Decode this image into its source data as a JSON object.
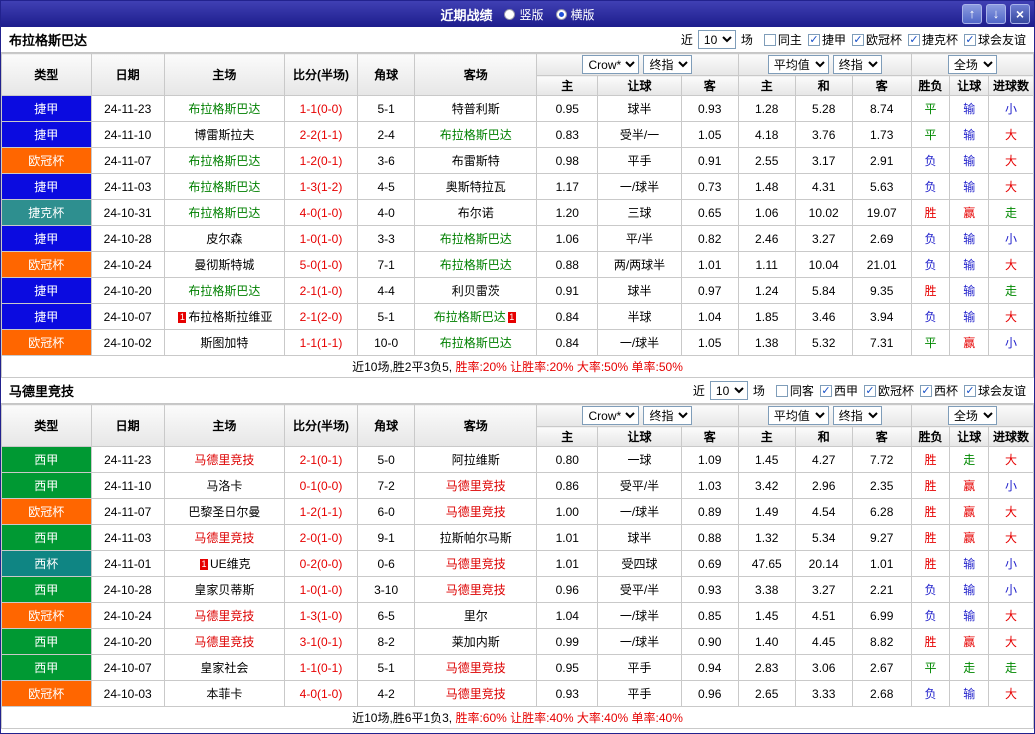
{
  "titlebar": {
    "title": "近期战绩",
    "views": [
      {
        "label": "竖版",
        "selected": false
      },
      {
        "label": "横版",
        "selected": true
      }
    ],
    "up": "↑",
    "down": "↓",
    "close": "×"
  },
  "league_colors": {
    "捷甲": "#0b0be0",
    "欧冠杯": "#ff6600",
    "捷克杯": "#2e8f8f",
    "西甲": "#009933",
    "西杯": "#0f8583"
  },
  "res_colors": {
    "r": "#e60000",
    "g": "#008800",
    "b": "#2222cc",
    "k": "#000000"
  },
  "sections": [
    {
      "team": "布拉格斯巴达",
      "focus_color": "#008000",
      "filters": {
        "near_label": "近",
        "count": "10",
        "games_label": "场",
        "checkboxes": [
          {
            "label": "同主",
            "checked": false
          },
          {
            "label": "捷甲",
            "checked": true
          },
          {
            "label": "欧冠杯",
            "checked": true
          },
          {
            "label": "捷克杯",
            "checked": true
          },
          {
            "label": "球会友谊",
            "checked": true
          }
        ]
      },
      "table": {
        "static_headers": [
          "类型",
          "日期",
          "主场",
          "比分(半场)",
          "角球",
          "客场"
        ],
        "odds_selects": [
          "Crow*",
          "终指"
        ],
        "odds_headers": [
          "主",
          "让球",
          "客"
        ],
        "avg_selects": [
          "平均值",
          "终指"
        ],
        "avg_headers": [
          "主",
          "和",
          "客"
        ],
        "result_select": "全场",
        "result_headers": [
          "胜负",
          "让球",
          "进球数"
        ],
        "rows": [
          {
            "league": "捷甲",
            "date": "24-11-23",
            "home": {
              "n": "布拉格斯巴达",
              "f": 1
            },
            "score": "1-1(0-0)",
            "corner": "5-1",
            "away": {
              "n": "特普利斯"
            },
            "odds": [
              "0.95",
              "球半",
              "0.93"
            ],
            "avg": [
              "1.28",
              "5.28",
              "8.74"
            ],
            "res": [
              [
                "平",
                "g"
              ],
              [
                "输",
                "b"
              ],
              [
                "小",
                "b"
              ]
            ]
          },
          {
            "league": "捷甲",
            "date": "24-11-10",
            "home": {
              "n": "博雷斯拉夫"
            },
            "score": "2-2(1-1)",
            "corner": "2-4",
            "away": {
              "n": "布拉格斯巴达",
              "f": 1
            },
            "odds": [
              "0.83",
              "受半/一",
              "1.05"
            ],
            "avg": [
              "4.18",
              "3.76",
              "1.73"
            ],
            "res": [
              [
                "平",
                "g"
              ],
              [
                "输",
                "b"
              ],
              [
                "大",
                "r"
              ]
            ]
          },
          {
            "league": "欧冠杯",
            "date": "24-11-07",
            "home": {
              "n": "布拉格斯巴达",
              "f": 1
            },
            "score": "1-2(0-1)",
            "corner": "3-6",
            "away": {
              "n": "布雷斯特"
            },
            "odds": [
              "0.98",
              "平手",
              "0.91"
            ],
            "avg": [
              "2.55",
              "3.17",
              "2.91"
            ],
            "res": [
              [
                "负",
                "b"
              ],
              [
                "输",
                "b"
              ],
              [
                "大",
                "r"
              ]
            ]
          },
          {
            "league": "捷甲",
            "date": "24-11-03",
            "home": {
              "n": "布拉格斯巴达",
              "f": 1
            },
            "score": "1-3(1-2)",
            "corner": "4-5",
            "away": {
              "n": "奥斯特拉瓦"
            },
            "odds": [
              "1.17",
              "一/球半",
              "0.73"
            ],
            "avg": [
              "1.48",
              "4.31",
              "5.63"
            ],
            "res": [
              [
                "负",
                "b"
              ],
              [
                "输",
                "b"
              ],
              [
                "大",
                "r"
              ]
            ]
          },
          {
            "league": "捷克杯",
            "date": "24-10-31",
            "home": {
              "n": "布拉格斯巴达",
              "f": 1
            },
            "score": "4-0(1-0)",
            "corner": "4-0",
            "away": {
              "n": "布尔诺"
            },
            "odds": [
              "1.20",
              "三球",
              "0.65"
            ],
            "avg": [
              "1.06",
              "10.02",
              "19.07"
            ],
            "res": [
              [
                "胜",
                "r"
              ],
              [
                "赢",
                "r"
              ],
              [
                "走",
                "g"
              ]
            ]
          },
          {
            "league": "捷甲",
            "date": "24-10-28",
            "home": {
              "n": "皮尔森"
            },
            "score": "1-0(1-0)",
            "corner": "3-3",
            "away": {
              "n": "布拉格斯巴达",
              "f": 1
            },
            "odds": [
              "1.06",
              "平/半",
              "0.82"
            ],
            "avg": [
              "2.46",
              "3.27",
              "2.69"
            ],
            "res": [
              [
                "负",
                "b"
              ],
              [
                "输",
                "b"
              ],
              [
                "小",
                "b"
              ]
            ]
          },
          {
            "league": "欧冠杯",
            "date": "24-10-24",
            "home": {
              "n": "曼彻斯特城"
            },
            "score": "5-0(1-0)",
            "corner": "7-1",
            "away": {
              "n": "布拉格斯巴达",
              "f": 1
            },
            "odds": [
              "0.88",
              "两/两球半",
              "1.01"
            ],
            "avg": [
              "1.11",
              "10.04",
              "21.01"
            ],
            "res": [
              [
                "负",
                "b"
              ],
              [
                "输",
                "b"
              ],
              [
                "大",
                "r"
              ]
            ]
          },
          {
            "league": "捷甲",
            "date": "24-10-20",
            "home": {
              "n": "布拉格斯巴达",
              "f": 1
            },
            "score": "2-1(1-0)",
            "corner": "4-4",
            "away": {
              "n": "利贝雷茨"
            },
            "odds": [
              "0.91",
              "球半",
              "0.97"
            ],
            "avg": [
              "1.24",
              "5.84",
              "9.35"
            ],
            "res": [
              [
                "胜",
                "r"
              ],
              [
                "输",
                "b"
              ],
              [
                "走",
                "g"
              ]
            ]
          },
          {
            "league": "捷甲",
            "date": "24-10-07",
            "home": {
              "n": "布拉格斯拉维亚",
              "rc": "L"
            },
            "score": "2-1(2-0)",
            "corner": "5-1",
            "away": {
              "n": "布拉格斯巴达",
              "f": 1,
              "rc": "R"
            },
            "odds": [
              "0.84",
              "半球",
              "1.04"
            ],
            "avg": [
              "1.85",
              "3.46",
              "3.94"
            ],
            "res": [
              [
                "负",
                "b"
              ],
              [
                "输",
                "b"
              ],
              [
                "大",
                "r"
              ]
            ]
          },
          {
            "league": "欧冠杯",
            "date": "24-10-02",
            "home": {
              "n": "斯图加特"
            },
            "score": "1-1(1-1)",
            "corner": "10-0",
            "away": {
              "n": "布拉格斯巴达",
              "f": 1
            },
            "odds": [
              "0.84",
              "一/球半",
              "1.05"
            ],
            "avg": [
              "1.38",
              "5.32",
              "7.31"
            ],
            "res": [
              [
                "平",
                "g"
              ],
              [
                "赢",
                "r"
              ],
              [
                "小",
                "b"
              ]
            ]
          }
        ],
        "summary": [
          [
            "近10场,胜2平3负5, ",
            "k"
          ],
          [
            "胜率:20% ",
            "r"
          ],
          [
            "让胜率:20% ",
            "r"
          ],
          [
            "大率:50% ",
            "r"
          ],
          [
            "单率:50%",
            "r"
          ]
        ]
      }
    },
    {
      "team": "马德里竞技",
      "focus_color": "#dd0000",
      "filters": {
        "near_label": "近",
        "count": "10",
        "games_label": "场",
        "checkboxes": [
          {
            "label": "同客",
            "checked": false
          },
          {
            "label": "西甲",
            "checked": true
          },
          {
            "label": "欧冠杯",
            "checked": true
          },
          {
            "label": "西杯",
            "checked": true
          },
          {
            "label": "球会友谊",
            "checked": true
          }
        ]
      },
      "table": {
        "static_headers": [
          "类型",
          "日期",
          "主场",
          "比分(半场)",
          "角球",
          "客场"
        ],
        "odds_selects": [
          "Crow*",
          "终指"
        ],
        "odds_headers": [
          "主",
          "让球",
          "客"
        ],
        "avg_selects": [
          "平均值",
          "终指"
        ],
        "avg_headers": [
          "主",
          "和",
          "客"
        ],
        "result_select": "全场",
        "result_headers": [
          "胜负",
          "让球",
          "进球数"
        ],
        "rows": [
          {
            "league": "西甲",
            "date": "24-11-23",
            "home": {
              "n": "马德里竞技",
              "f": 1
            },
            "score": "2-1(0-1)",
            "corner": "5-0",
            "away": {
              "n": "阿拉维斯"
            },
            "odds": [
              "0.80",
              "一球",
              "1.09"
            ],
            "avg": [
              "1.45",
              "4.27",
              "7.72"
            ],
            "res": [
              [
                "胜",
                "r"
              ],
              [
                "走",
                "g"
              ],
              [
                "大",
                "r"
              ]
            ]
          },
          {
            "league": "西甲",
            "date": "24-11-10",
            "home": {
              "n": "马洛卡"
            },
            "score": "0-1(0-0)",
            "corner": "7-2",
            "away": {
              "n": "马德里竞技",
              "f": 1
            },
            "odds": [
              "0.86",
              "受平/半",
              "1.03"
            ],
            "avg": [
              "3.42",
              "2.96",
              "2.35"
            ],
            "res": [
              [
                "胜",
                "r"
              ],
              [
                "赢",
                "r"
              ],
              [
                "小",
                "b"
              ]
            ]
          },
          {
            "league": "欧冠杯",
            "date": "24-11-07",
            "home": {
              "n": "巴黎圣日尔曼"
            },
            "score": "1-2(1-1)",
            "corner": "6-0",
            "away": {
              "n": "马德里竞技",
              "f": 1
            },
            "odds": [
              "1.00",
              "一/球半",
              "0.89"
            ],
            "avg": [
              "1.49",
              "4.54",
              "6.28"
            ],
            "res": [
              [
                "胜",
                "r"
              ],
              [
                "赢",
                "r"
              ],
              [
                "大",
                "r"
              ]
            ]
          },
          {
            "league": "西甲",
            "date": "24-11-03",
            "home": {
              "n": "马德里竞技",
              "f": 1
            },
            "score": "2-0(1-0)",
            "corner": "9-1",
            "away": {
              "n": "拉斯帕尔马斯"
            },
            "odds": [
              "1.01",
              "球半",
              "0.88"
            ],
            "avg": [
              "1.32",
              "5.34",
              "9.27"
            ],
            "res": [
              [
                "胜",
                "r"
              ],
              [
                "赢",
                "r"
              ],
              [
                "大",
                "r"
              ]
            ]
          },
          {
            "league": "西杯",
            "date": "24-11-01",
            "home": {
              "n": "UE维克",
              "rc": "L"
            },
            "score": "0-2(0-0)",
            "corner": "0-6",
            "away": {
              "n": "马德里竞技",
              "f": 1
            },
            "odds": [
              "1.01",
              "受四球",
              "0.69"
            ],
            "avg": [
              "47.65",
              "20.14",
              "1.01"
            ],
            "res": [
              [
                "胜",
                "r"
              ],
              [
                "输",
                "b"
              ],
              [
                "小",
                "b"
              ]
            ]
          },
          {
            "league": "西甲",
            "date": "24-10-28",
            "home": {
              "n": "皇家贝蒂斯"
            },
            "score": "1-0(1-0)",
            "corner": "3-10",
            "away": {
              "n": "马德里竞技",
              "f": 1
            },
            "odds": [
              "0.96",
              "受平/半",
              "0.93"
            ],
            "avg": [
              "3.38",
              "3.27",
              "2.21"
            ],
            "res": [
              [
                "负",
                "b"
              ],
              [
                "输",
                "b"
              ],
              [
                "小",
                "b"
              ]
            ]
          },
          {
            "league": "欧冠杯",
            "date": "24-10-24",
            "home": {
              "n": "马德里竞技",
              "f": 1
            },
            "score": "1-3(1-0)",
            "corner": "6-5",
            "away": {
              "n": "里尔"
            },
            "odds": [
              "1.04",
              "一/球半",
              "0.85"
            ],
            "avg": [
              "1.45",
              "4.51",
              "6.99"
            ],
            "res": [
              [
                "负",
                "b"
              ],
              [
                "输",
                "b"
              ],
              [
                "大",
                "r"
              ]
            ]
          },
          {
            "league": "西甲",
            "date": "24-10-20",
            "home": {
              "n": "马德里竞技",
              "f": 1
            },
            "score": "3-1(0-1)",
            "corner": "8-2",
            "away": {
              "n": "莱加内斯"
            },
            "odds": [
              "0.99",
              "一/球半",
              "0.90"
            ],
            "avg": [
              "1.40",
              "4.45",
              "8.82"
            ],
            "res": [
              [
                "胜",
                "r"
              ],
              [
                "赢",
                "r"
              ],
              [
                "大",
                "r"
              ]
            ]
          },
          {
            "league": "西甲",
            "date": "24-10-07",
            "home": {
              "n": "皇家社会"
            },
            "score": "1-1(0-1)",
            "corner": "5-1",
            "away": {
              "n": "马德里竞技",
              "f": 1
            },
            "odds": [
              "0.95",
              "平手",
              "0.94"
            ],
            "avg": [
              "2.83",
              "3.06",
              "2.67"
            ],
            "res": [
              [
                "平",
                "g"
              ],
              [
                "走",
                "g"
              ],
              [
                "走",
                "g"
              ]
            ]
          },
          {
            "league": "欧冠杯",
            "date": "24-10-03",
            "home": {
              "n": "本菲卡"
            },
            "score": "4-0(1-0)",
            "corner": "4-2",
            "away": {
              "n": "马德里竞技",
              "f": 1
            },
            "odds": [
              "0.93",
              "平手",
              "0.96"
            ],
            "avg": [
              "2.65",
              "3.33",
              "2.68"
            ],
            "res": [
              [
                "负",
                "b"
              ],
              [
                "输",
                "b"
              ],
              [
                "大",
                "r"
              ]
            ]
          }
        ],
        "summary": [
          [
            "近10场,胜6平1负3, ",
            "k"
          ],
          [
            "胜率:60% ",
            "r"
          ],
          [
            "让胜率:40% ",
            "r"
          ],
          [
            "大率:40% ",
            "r"
          ],
          [
            "单率:40%",
            "r"
          ]
        ]
      }
    }
  ]
}
